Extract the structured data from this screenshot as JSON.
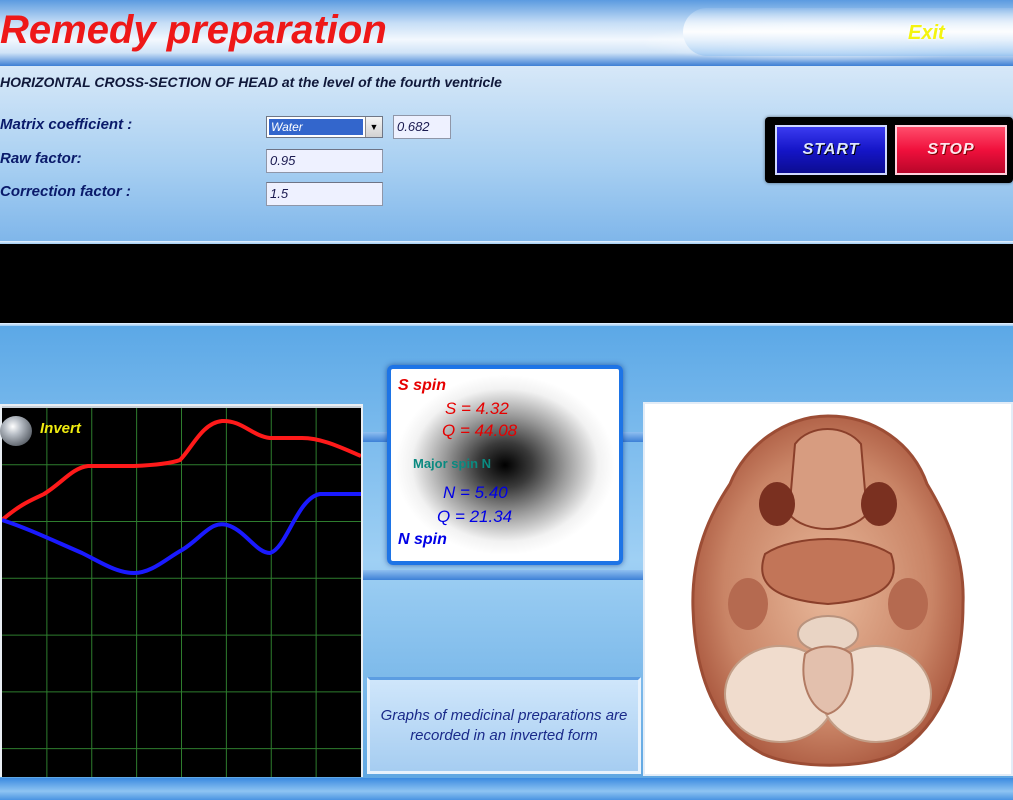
{
  "app": {
    "title": "Remedy preparation",
    "exit_label": "Exit"
  },
  "settings": {
    "subtitle": "HORIZONTAL CROSS-SECTION OF HEAD at the level of the fourth ventricle",
    "matrix_label": "Matrix coefficient :",
    "matrix_selected": "Water",
    "matrix_value": "0.682",
    "raw_label": "Raw factor:",
    "raw_value": "0.95",
    "correction_label": "Correction factor :",
    "correction_value": "1.5"
  },
  "controls": {
    "start_label": "START",
    "stop_label": "STOP"
  },
  "graph": {
    "invert_label": "Invert",
    "colors": {
      "s_line": "#ff1a1a",
      "n_line": "#1a1aff",
      "grid": "#2e7d2e"
    }
  },
  "spin": {
    "s_title": "S spin",
    "s_value": "S = 4.32",
    "s_q": "Q = 44.08",
    "major": "Major spin N",
    "n_value": "N = 5.40",
    "n_q": "Q = 21.34",
    "n_title": "N spin"
  },
  "note": {
    "text": "Graphs of medicinal preparations are recorded in an inverted form"
  },
  "colors": {
    "title_red": "#ee1818",
    "exit_yellow": "#f4f410",
    "start_blue": "#1515c8",
    "stop_red": "#f0103c"
  }
}
